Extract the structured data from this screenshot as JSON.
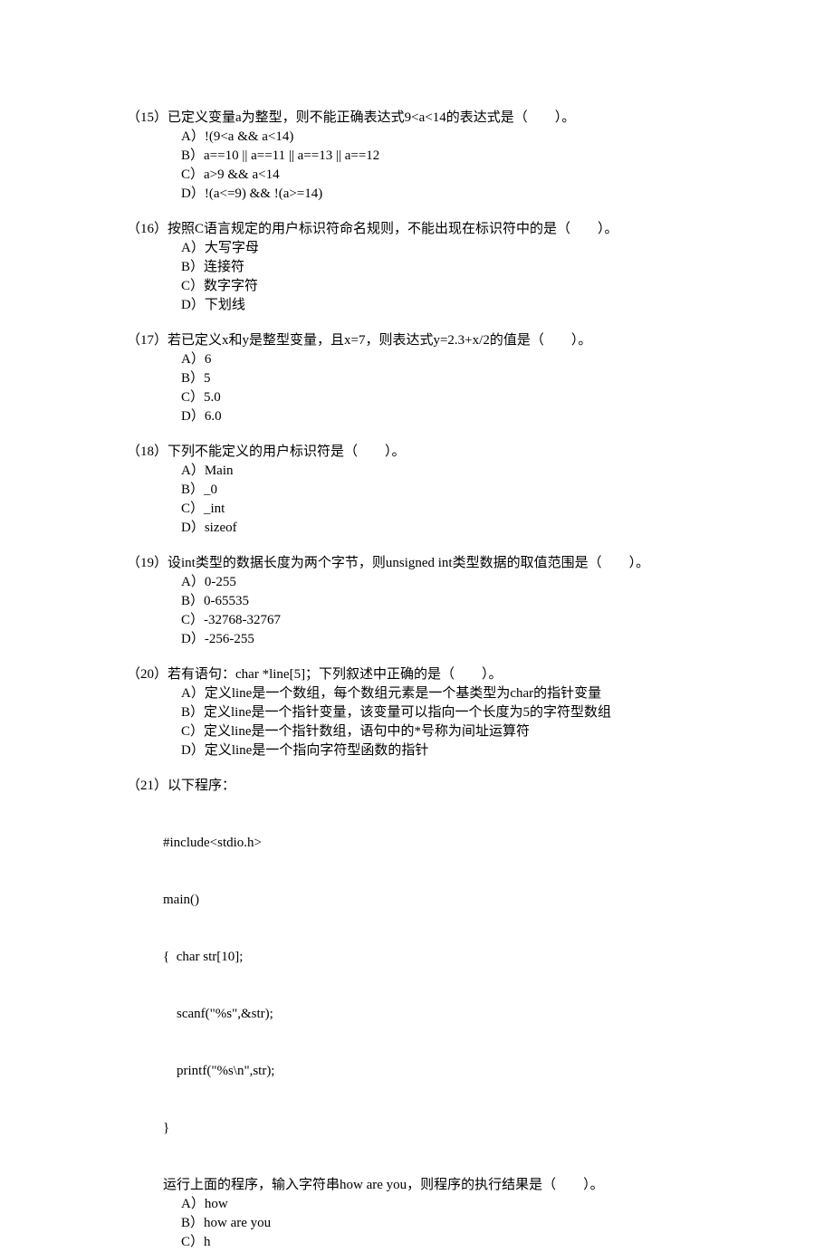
{
  "q15": {
    "num": "（15）",
    "stem": "已定义变量a为整型，则不能正确表达式9<a<14的表达式是（　　）。",
    "a": "A）!(9<a && a<14)",
    "b": "B）a==10 || a==11 || a==13 || a==12",
    "c": "C）a>9 && a<14",
    "d": "D）!(a<=9) && !(a>=14)"
  },
  "q16": {
    "num": "（16）",
    "stem": "按照C语言规定的用户标识符命名规则，不能出现在标识符中的是（　　）。",
    "a": "A）大写字母",
    "b": "B）连接符",
    "c": "C）数字字符",
    "d": "D）下划线"
  },
  "q17": {
    "num": "（17）",
    "stem": "若已定义x和y是整型变量，且x=7，则表达式y=2.3+x/2的值是（　　）。",
    "a": "A）6",
    "b": "B）5",
    "c": "C）5.0",
    "d": "D）6.0"
  },
  "q18": {
    "num": "（18）",
    "stem": "下列不能定义的用户标识符是（　　）。",
    "a": "A）Main",
    "b": "B）_0",
    "c": "C）_int",
    "d": "D）sizeof"
  },
  "q19": {
    "num": "（19）",
    "stem": "设int类型的数据长度为两个字节，则unsigned int类型数据的取值范围是（　　）。",
    "a": "A）0-255",
    "b": "B）0-65535",
    "c": "C）-32768-32767",
    "d": "D）-256-255"
  },
  "q20": {
    "num": "（20）",
    "stem": "若有语句：char *line[5]；下列叙述中正确的是（　　）。",
    "a": "A）定义line是一个数组，每个数组元素是一个基类型为char的指针变量",
    "b": "B）定义line是一个指针变量，该变量可以指向一个长度为5的字符型数组",
    "c": "C）定义line是一个指针数组，语句中的*号称为间址运算符",
    "d": "D）定义line是一个指向字符型函数的指针"
  },
  "q21": {
    "num": "（21）",
    "stem": "以下程序：",
    "code1": "#include<stdio.h>",
    "code2": "main()",
    "code3": "{  char str[10];",
    "code4": "    scanf(\"%s\",&str);",
    "code5": "    printf(\"%s\\n\",str);",
    "code6": "}",
    "after": "运行上面的程序，输入字符串how are you，则程序的执行结果是（　　）。",
    "a": "A）how",
    "b": "B）how are you",
    "c": "C）h"
  }
}
